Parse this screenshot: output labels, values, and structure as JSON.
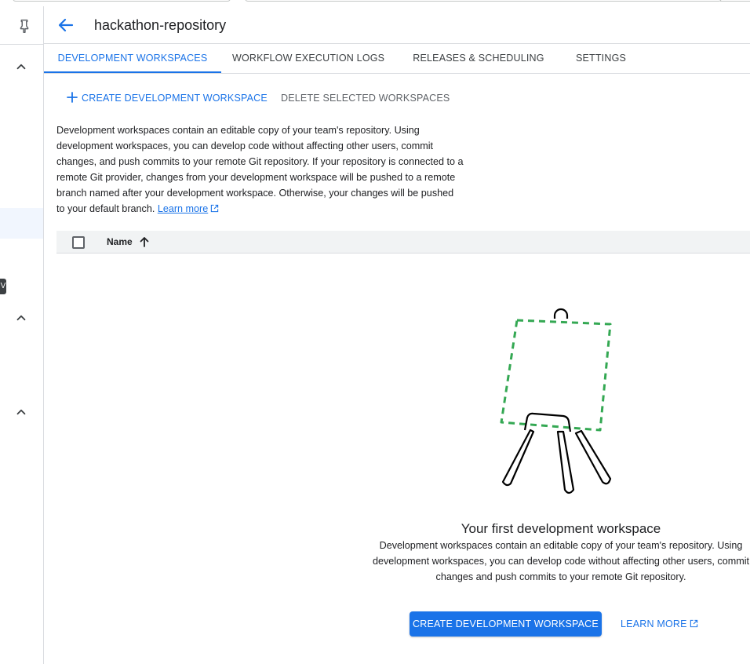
{
  "header": {
    "title": "hackathon-repository"
  },
  "rail": {
    "tag_text": "V"
  },
  "tabs": [
    {
      "label": "DEVELOPMENT WORKSPACES",
      "active": true
    },
    {
      "label": "WORKFLOW EXECUTION LOGS",
      "active": false
    },
    {
      "label": "RELEASES & SCHEDULING",
      "active": false
    },
    {
      "label": "SETTINGS",
      "active": false
    }
  ],
  "actions": {
    "create_label": "CREATE DEVELOPMENT WORKSPACE",
    "delete_label": "DELETE SELECTED WORKSPACES"
  },
  "description": {
    "text": "Development workspaces contain an editable copy of your team's repository. Using development workspaces, you can develop code without affecting other users, commit changes, and push commits to your remote Git repository. If your repository is connected to a remote Git provider, changes from your development workspace will be pushed to a remote branch named after your development workspace. Otherwise, your changes will be pushed to your default branch.",
    "link": "Learn more"
  },
  "table": {
    "column_name": "Name",
    "sort": "ascending"
  },
  "empty_state": {
    "title": "Your first development workspace",
    "body": "Development workspaces contain an editable copy of your team's repository. Using development workspaces, you can develop code without affecting other users, commit changes and push commits to your remote Git repository.",
    "primary_button": "CREATE DEVELOPMENT WORKSPACE",
    "secondary_link": "LEARN MORE"
  },
  "colors": {
    "accent": "#1a73e8",
    "illustration_dash": "#34a853",
    "divider": "#dadce0"
  },
  "icons": {
    "rail_top": "pin-icon",
    "rail_sections": "chevron-up-icon",
    "back": "arrow-back-icon",
    "create": "plus-icon",
    "external": "open-in-new-icon",
    "sort": "arrow-up-icon"
  }
}
